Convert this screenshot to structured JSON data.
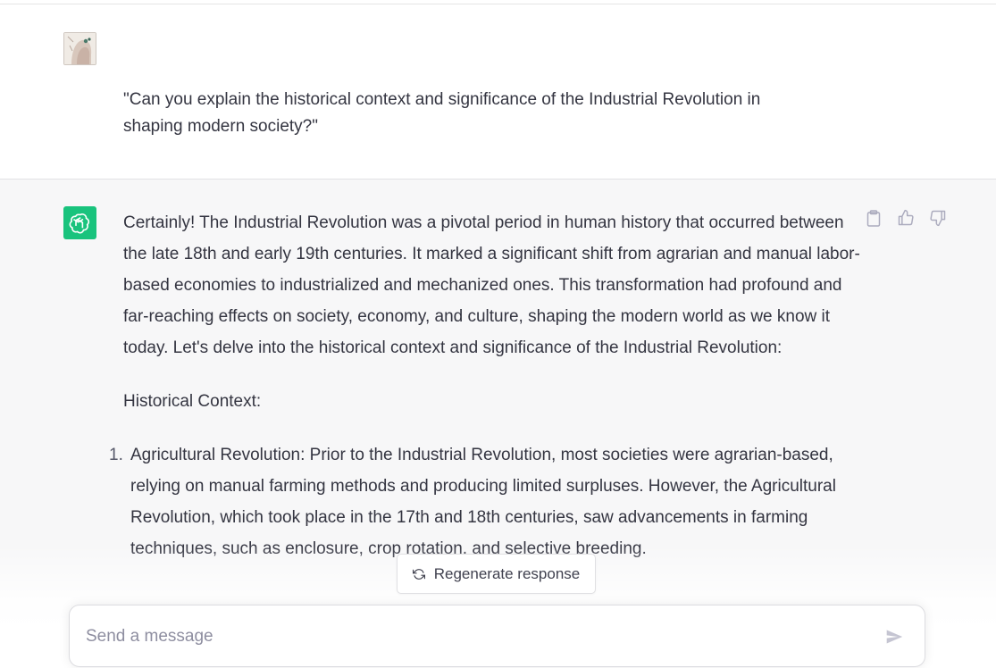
{
  "user_message": {
    "text": "\"Can you explain the historical context and significance of the Industrial Revolution in shaping modern society?\""
  },
  "assistant_message": {
    "intro": "Certainly! The Industrial Revolution was a pivotal period in human history that occurred between the late 18th and early 19th centuries. It marked a significant shift from agrarian and manual labor-based economies to industrialized and mechanized ones. This transformation had profound and far-reaching effects on society, economy, and culture, shaping the modern world as we know it today. Let's delve into the historical context and significance of the Industrial Revolution:",
    "heading": "Historical Context:",
    "list": [
      {
        "number": "1.",
        "text": "Agricultural Revolution: Prior to the Industrial Revolution, most societies were agrarian-based, relying on manual farming methods and producing limited surpluses. However, the Agricultural Revolution, which took place in the 17th and 18th centuries, saw advancements in farming techniques, such as enclosure, crop rotation, and selective breeding."
      }
    ]
  },
  "regenerate": {
    "label": "Regenerate response"
  },
  "composer": {
    "placeholder": "Send a message"
  },
  "colors": {
    "accent": "#19c37d",
    "assistant_bg": "#f7f7f8",
    "text": "#343541"
  }
}
